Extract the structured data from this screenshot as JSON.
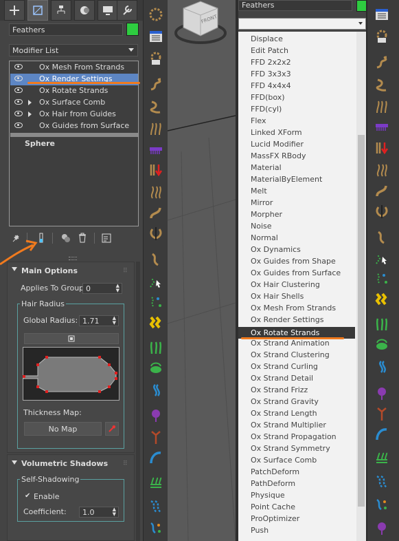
{
  "left_panel": {
    "object_name": "Feathers",
    "modifier_list_label": "Modifier List",
    "stack": [
      {
        "label": "Ox Mesh From Strands",
        "eye": true,
        "expand": false,
        "selected": false
      },
      {
        "label": "Ox Render Settings",
        "eye": true,
        "expand": false,
        "selected": true
      },
      {
        "label": "Ox Rotate Strands",
        "eye": true,
        "expand": false,
        "selected": false
      },
      {
        "label": "Ox Surface Comb",
        "eye": true,
        "expand": true,
        "selected": false
      },
      {
        "label": "Ox Hair from Guides",
        "eye": true,
        "expand": true,
        "selected": false
      },
      {
        "label": "Ox Guides from Surface",
        "eye": true,
        "expand": false,
        "selected": false
      }
    ],
    "base_object": "Sphere",
    "main_options": {
      "title": "Main Options",
      "applies_to_group_label": "Applies To Group:",
      "applies_to_group_value": "0",
      "hair_radius_title": "Hair Radius",
      "global_radius_label": "Global Radius:",
      "global_radius_value": "1.71",
      "thickness_map_label": "Thickness Map:",
      "no_map_label": "No Map"
    },
    "volumetric_shadows": {
      "title": "Volumetric Shadows",
      "self_shadowing_title": "Self-Shadowing",
      "enable_label": "Enable",
      "enable_checked": true,
      "coefficient_label": "Coefficient:",
      "coefficient_value": "1.0"
    }
  },
  "right_panel": {
    "object_name": "Feathers",
    "modifier_items": [
      "Displace",
      "Edit Patch",
      "FFD 2x2x2",
      "FFD 3x3x3",
      "FFD 4x4x4",
      "FFD(box)",
      "FFD(cyl)",
      "Flex",
      "Linked XForm",
      "Lucid Modifier",
      "MassFX RBody",
      "Material",
      "MaterialByElement",
      "Melt",
      "Mirror",
      "Morpher",
      "Noise",
      "Normal",
      "Ox Dynamics",
      "Ox Guides from Shape",
      "Ox Guides from Surface",
      "Ox Hair Clustering",
      "Ox Hair Shells",
      "Ox Mesh From Strands",
      "Ox Render Settings",
      "Ox Rotate Strands",
      "Ox Strand Animation",
      "Ox Strand Clustering",
      "Ox Strand Curling",
      "Ox Strand Detail",
      "Ox Strand Frizz",
      "Ox Strand Gravity",
      "Ox Strand Length",
      "Ox Strand Multiplier",
      "Ox Strand Propagation",
      "Ox Strand Symmetry",
      "Ox Surface Comb",
      "PatchDeform",
      "PathDeform",
      "Physique",
      "Point Cache",
      "ProOptimizer",
      "Push"
    ],
    "selected_item": "Ox Rotate Strands"
  },
  "viewcube_label": "FRONT",
  "colors": {
    "accent_orange": "#f07a1e",
    "swatch_green": "#2ecc40",
    "selection_blue": "#5d86c4"
  }
}
